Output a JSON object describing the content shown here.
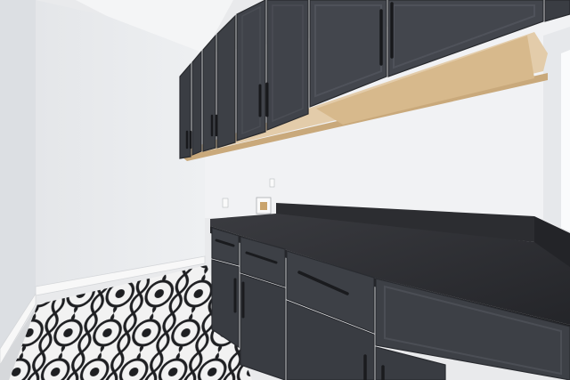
{
  "scene": {
    "subject": "laundry room",
    "colors": {
      "wall_left": "#e2e4e7",
      "wall_back": "#eceef0",
      "wall_right": "#f1f2f4",
      "ceiling": "#f4f5f6",
      "cabinet": "#3c3f45",
      "cabinet_dark": "#2b2d32",
      "cabinet_panel": "#474a51",
      "wood": "#d9bf96",
      "countertop": "#2e2f33",
      "floor_light": "#f2f2f2",
      "floor_dark": "#1e1f22",
      "baseboard": "#f7f7f7",
      "handle": "#1a1b1e"
    }
  }
}
